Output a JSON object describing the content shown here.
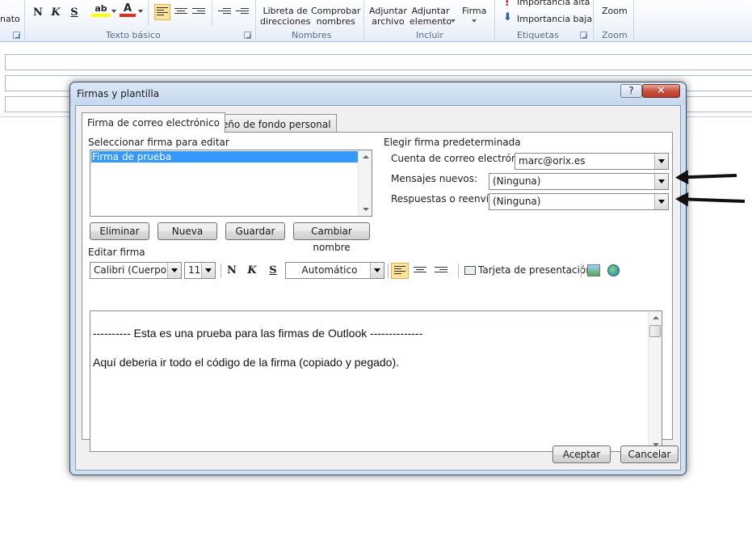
{
  "ribbon": {
    "left_cut_label": "nato",
    "bold": "N",
    "italic": "K",
    "underline": "S",
    "highlight": "ab",
    "font_color": "A",
    "group_basic_text": "Texto básico",
    "address_book": "Libreta de\ndirecciones",
    "check_names": "Comprobar\nnombres",
    "group_names": "Nombres",
    "attach_file": "Adjuntar\narchivo",
    "attach_item": "Adjuntar\nelemento",
    "signature": "Firma",
    "group_include": "Incluir",
    "high_importance": "Importancia alta",
    "low_importance": "Importancia baja",
    "group_tags": "Etiquetas",
    "zoom": "Zoom",
    "group_zoom": "Zoom",
    "highlight_color": "#ffff00",
    "font_color_value": "#e0301e"
  },
  "dialog": {
    "title": "Firmas y plantilla",
    "help": "?",
    "close": "✕",
    "tabs": [
      {
        "label": "Firma de correo electrónico",
        "active": true
      },
      {
        "label": "Diseño de fondo personal",
        "active": false
      }
    ],
    "select_label": "Seleccionar firma para editar",
    "signatures": [
      "Firma de prueba"
    ],
    "buttons": {
      "delete": "Eliminar",
      "new": "Nueva",
      "save": "Guardar",
      "rename": "Cambiar nombre"
    },
    "default_sig": {
      "heading": "Elegir firma predeterminada",
      "account_label": "Cuenta de correo electrónico:",
      "account_value": "marc@orix.es",
      "new_label": "Mensajes nuevos:",
      "new_value": "(Ninguna)",
      "reply_label": "Respuestas o reenvíos:",
      "reply_value": "(Ninguna)"
    },
    "edit": {
      "heading": "Editar firma",
      "font": "Calibri (Cuerpo)",
      "size": "11",
      "bold": "N",
      "italic": "K",
      "underline": "S",
      "color": "Automático",
      "business_card": "Tarjeta de presentación",
      "lines": [
        "---------- Esta es una prueba para las firmas de Outlook --------------",
        "Aquí deberia ir todo el código de la firma (copiado y pegado)."
      ]
    },
    "ok": "Aceptar",
    "cancel": "Cancelar"
  }
}
